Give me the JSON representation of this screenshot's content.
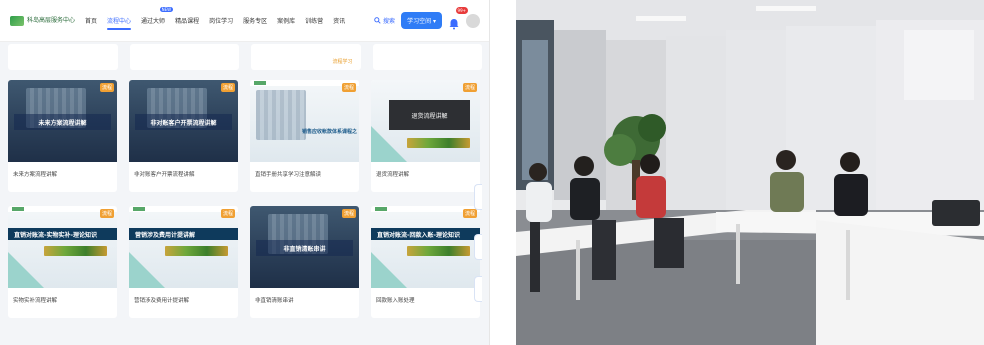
{
  "nav": {
    "logo_text": "科岛高层服务中心",
    "items": [
      "首页",
      "流程中心",
      "通过大师",
      "精品课程",
      "岗位学习",
      "服务专区",
      "案例库",
      "训练营",
      "资讯"
    ],
    "active_index": 1,
    "new_badge": "NEW",
    "search_label": "搜索",
    "study_button": "学习空间",
    "notification_count": "99+"
  },
  "top_tag": "流程学习",
  "cards": [
    {
      "badge": "流程",
      "banner": "未来方案流程讲解",
      "title": "未来方案流程讲解",
      "style": "dark"
    },
    {
      "badge": "流程",
      "banner": "非对账客户开票流程讲解",
      "title": "非对账客户开票流程讲解",
      "style": "dark"
    },
    {
      "badge": "流程",
      "banner": "销售应收帐款体系课程之",
      "title": "直销手册共享学习注意解读",
      "style": "light"
    },
    {
      "badge": "流程",
      "banner": "退货流程讲解",
      "title": "退货流程讲解",
      "style": "darkblock"
    },
    {
      "badge": "流程",
      "banner": "直销对账流-实物实补-理论知识",
      "title": "实物实补流程讲解",
      "style": "stripe"
    },
    {
      "badge": "流程",
      "banner": "营销涉及费用计提讲解",
      "title": "营销涉及费用计提讲解",
      "style": "stripe"
    },
    {
      "badge": "流程",
      "banner": "非直销清账串讲",
      "title": "非直销清账串讲",
      "style": "dark"
    },
    {
      "badge": "流程",
      "banner": "直销对账流-回款入账-理论知识",
      "title": "回款账入账处理",
      "style": "stripe"
    }
  ],
  "colors": {
    "accent": "#2f7cf6",
    "badge": "#f0a033"
  }
}
